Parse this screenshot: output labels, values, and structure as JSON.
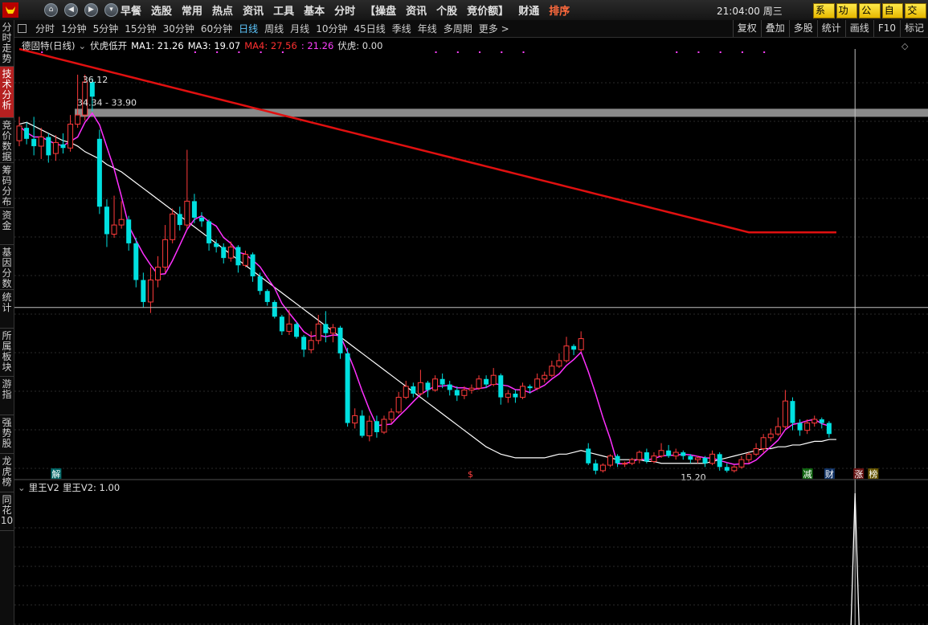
{
  "topbar": {
    "menu": [
      "早餐",
      "选股",
      "常用",
      "热点",
      "资讯",
      "工具",
      "基本",
      "分时",
      "【操盘",
      "资讯",
      "个股",
      "竞价额】",
      "财通",
      "排序"
    ],
    "clock": "21:04:00 周三",
    "right_buttons": [
      "系统",
      "功能",
      "公式",
      "自选",
      "交易"
    ],
    "colors": {
      "highlight": "#ff6a3d",
      "button_bg": "#ffd700"
    }
  },
  "periods": [
    "分时",
    "1分钟",
    "5分钟",
    "15分钟",
    "30分钟",
    "60分钟",
    "日线",
    "周线",
    "月线",
    "10分钟",
    "45日线",
    "季线",
    "年线",
    "多周期",
    "更多 >"
  ],
  "active_period": "日线",
  "tools": [
    "复权",
    "叠加",
    "多股",
    "统计",
    "画线",
    "F10",
    "标记"
  ],
  "sidebar": [
    {
      "label": "分时走势",
      "active": false
    },
    {
      "label": "技术分析",
      "active": true
    },
    {
      "label": "竞价数据",
      "active": false
    },
    {
      "label": "筹码分布",
      "active": false
    },
    {
      "label": "资金",
      "active": false
    },
    {
      "label": "基因分数",
      "active": false
    },
    {
      "label": "统计",
      "active": false
    },
    {
      "label": "所属板块",
      "active": false
    },
    {
      "label": "游指",
      "active": false
    },
    {
      "label": "强势股",
      "active": false
    },
    {
      "label": "龙虎榜",
      "active": false
    },
    {
      "label": "同花10",
      "active": false
    }
  ],
  "main_header": {
    "stock": "德固特(日线)",
    "indicator": "伏虎低开",
    "ma1": "MA1: 21.26",
    "ma3": "MA3: 19.07",
    "ma4": "MA4: 27.56",
    "ma_extra": ": 21.26",
    "fuhu": "伏虎: 0.00",
    "colors": {
      "ma1": "#ffffff",
      "ma3": "#ffffff",
      "ma4": "#ff3030",
      "ma_extra": "#ff40ff",
      "fuhu": "#dddddd"
    }
  },
  "lower_header": {
    "name": "里王V2",
    "value": "里王V2: 1.00"
  },
  "annotations": {
    "high": "36.12",
    "range": "34.34 - 33.90",
    "low": "15.20"
  },
  "markers": [
    {
      "text": "解",
      "bg": "#006666",
      "fg": "#ffffff",
      "k": 5
    },
    {
      "text": "$",
      "bg": "#000000",
      "fg": "#ff4040",
      "k": 62
    },
    {
      "text": "减",
      "bg": "#116611",
      "fg": "#ffffff",
      "k": 108
    },
    {
      "text": "财",
      "bg": "#113366",
      "fg": "#ffffff",
      "k": 111
    },
    {
      "text": "涨",
      "bg": "#661111",
      "fg": "#ffffff",
      "k": 115
    },
    {
      "text": "榜",
      "bg": "#665500",
      "fg": "#ffffff",
      "k": 117
    }
  ],
  "chart_data": {
    "type": "candlestick",
    "y_range": [
      14.2,
      37.6
    ],
    "resistance_band": [
      33.9,
      34.34
    ],
    "crosshair_price": 23.5,
    "crosshair_index": 115,
    "candles": [
      [
        32.6,
        33.4,
        33.9,
        32.3
      ],
      [
        33.3,
        32.7,
        33.6,
        32.4
      ],
      [
        32.7,
        32.3,
        33.9,
        31.8
      ],
      [
        32.3,
        32.8,
        33.3,
        31.6
      ],
      [
        32.8,
        31.8,
        33.0,
        31.4
      ],
      [
        31.9,
        32.5,
        32.9,
        31.5
      ],
      [
        32.4,
        32.2,
        33.0,
        31.9
      ],
      [
        32.2,
        33.5,
        34.0,
        32.0
      ],
      [
        33.5,
        34.0,
        36.2,
        33.3
      ],
      [
        34.0,
        35.8,
        36.2,
        33.7
      ],
      [
        35.8,
        35.0,
        36.0,
        34.2
      ],
      [
        32.7,
        29.0,
        33.2,
        28.6
      ],
      [
        29.0,
        27.5,
        29.4,
        26.8
      ],
      [
        27.5,
        28.0,
        29.6,
        27.3
      ],
      [
        28.0,
        28.3,
        29.3,
        27.8
      ],
      [
        28.3,
        27.0,
        28.5,
        26.6
      ],
      [
        27.0,
        25.0,
        27.3,
        24.6
      ],
      [
        25.0,
        23.8,
        25.4,
        23.5
      ],
      [
        23.8,
        25.0,
        25.7,
        23.2
      ],
      [
        25.0,
        25.7,
        26.3,
        24.6
      ],
      [
        25.7,
        27.2,
        28.0,
        25.4
      ],
      [
        27.2,
        28.6,
        28.9,
        27.0
      ],
      [
        28.6,
        28.0,
        29.0,
        27.7
      ],
      [
        28.0,
        29.3,
        32.1,
        27.8
      ],
      [
        29.3,
        28.4,
        29.7,
        28.1
      ],
      [
        28.4,
        28.2,
        28.7,
        27.9
      ],
      [
        28.2,
        27.0,
        28.3,
        26.6
      ],
      [
        27.0,
        26.8,
        27.2,
        26.5
      ],
      [
        26.8,
        26.2,
        27.0,
        25.9
      ],
      [
        26.2,
        26.8,
        27.1,
        26.0
      ],
      [
        26.8,
        25.8,
        26.9,
        25.4
      ],
      [
        25.8,
        26.4,
        26.6,
        25.7
      ],
      [
        26.4,
        25.2,
        26.5,
        24.9
      ],
      [
        25.2,
        24.4,
        25.4,
        24.2
      ],
      [
        24.4,
        23.8,
        24.5,
        23.6
      ],
      [
        23.8,
        23.0,
        23.9,
        22.9
      ],
      [
        23.0,
        22.2,
        23.1,
        22.0
      ],
      [
        22.2,
        22.6,
        23.4,
        22.0
      ],
      [
        22.6,
        21.9,
        22.7,
        21.8
      ],
      [
        21.9,
        21.2,
        22.0,
        20.8
      ],
      [
        21.2,
        21.7,
        22.2,
        21.0
      ],
      [
        21.7,
        22.6,
        23.1,
        21.5
      ],
      [
        22.6,
        22.1,
        23.3,
        21.6
      ],
      [
        22.1,
        22.4,
        22.6,
        21.6
      ],
      [
        22.4,
        21.0,
        22.5,
        20.7
      ],
      [
        21.0,
        17.2,
        21.3,
        17.0
      ],
      [
        17.2,
        17.6,
        18.0,
        16.9
      ],
      [
        17.6,
        16.5,
        17.9,
        16.4
      ],
      [
        16.5,
        17.3,
        17.6,
        16.2
      ],
      [
        17.3,
        16.7,
        17.6,
        16.4
      ],
      [
        16.7,
        17.4,
        17.6,
        16.6
      ],
      [
        17.4,
        17.8,
        18.0,
        17.2
      ],
      [
        17.8,
        18.6,
        18.9,
        17.7
      ],
      [
        18.6,
        19.2,
        19.5,
        18.5
      ],
      [
        19.2,
        18.8,
        19.4,
        18.6
      ],
      [
        18.8,
        19.4,
        20.1,
        18.7
      ],
      [
        19.4,
        19.0,
        19.5,
        18.6
      ],
      [
        19.0,
        19.6,
        19.8,
        18.9
      ],
      [
        19.6,
        19.3,
        19.9,
        19.1
      ],
      [
        19.3,
        19.0,
        19.5,
        18.7
      ],
      [
        19.0,
        18.7,
        19.2,
        18.4
      ],
      [
        18.7,
        19.0,
        19.2,
        18.5
      ],
      [
        19.0,
        19.1,
        19.3,
        18.8
      ],
      [
        19.1,
        19.6,
        19.8,
        19.0
      ],
      [
        19.6,
        19.3,
        19.8,
        19.1
      ],
      [
        19.3,
        19.8,
        20.2,
        19.2
      ],
      [
        19.8,
        18.6,
        19.9,
        18.2
      ],
      [
        18.6,
        18.8,
        19.0,
        18.3
      ],
      [
        18.8,
        18.6,
        19.0,
        18.3
      ],
      [
        18.6,
        19.2,
        19.4,
        18.5
      ],
      [
        19.2,
        19.1,
        19.3,
        18.8
      ],
      [
        19.1,
        19.6,
        19.9,
        19.0
      ],
      [
        19.6,
        19.8,
        20.0,
        19.4
      ],
      [
        19.8,
        20.3,
        20.6,
        19.7
      ],
      [
        20.3,
        20.6,
        21.0,
        20.2
      ],
      [
        20.6,
        21.4,
        21.9,
        20.5
      ],
      [
        21.4,
        21.2,
        21.5,
        20.9
      ],
      [
        21.2,
        21.8,
        22.2,
        21.1
      ],
      [
        15.8,
        15.0,
        16.1,
        14.9
      ],
      [
        15.0,
        14.6,
        15.2,
        14.4
      ],
      [
        14.6,
        14.9,
        15.0,
        14.5
      ],
      [
        14.9,
        15.4,
        15.5,
        14.8
      ],
      [
        15.4,
        15.0,
        15.5,
        14.8
      ],
      [
        15.0,
        15.0,
        15.1,
        14.8
      ],
      [
        15.0,
        15.2,
        15.3,
        14.9
      ],
      [
        15.2,
        15.6,
        15.7,
        15.0
      ],
      [
        15.6,
        15.1,
        15.8,
        15.0
      ],
      [
        15.1,
        15.4,
        15.6,
        15.0
      ],
      [
        15.4,
        15.7,
        16.1,
        15.3
      ],
      [
        15.7,
        15.4,
        16.0,
        15.3
      ],
      [
        15.4,
        15.6,
        15.8,
        15.2
      ],
      [
        15.6,
        15.4,
        15.7,
        15.2
      ],
      [
        15.4,
        15.2,
        15.5,
        15.0
      ],
      [
        15.2,
        15.3,
        15.4,
        15.0
      ],
      [
        15.3,
        15.0,
        15.4,
        14.8
      ],
      [
        15.0,
        15.5,
        15.7,
        14.9
      ],
      [
        15.5,
        14.8,
        15.6,
        14.6
      ],
      [
        14.8,
        14.6,
        15.0,
        14.5
      ],
      [
        14.6,
        14.8,
        14.9,
        14.5
      ],
      [
        14.8,
        15.2,
        15.4,
        14.7
      ],
      [
        15.2,
        15.5,
        15.6,
        15.0
      ],
      [
        15.5,
        15.8,
        16.1,
        15.4
      ],
      [
        15.8,
        16.4,
        16.6,
        15.6
      ],
      [
        16.4,
        16.6,
        16.9,
        16.2
      ],
      [
        16.6,
        17.0,
        17.5,
        16.5
      ],
      [
        17.0,
        18.4,
        19.0,
        16.9
      ],
      [
        18.4,
        17.2,
        18.6,
        16.8
      ],
      [
        17.2,
        16.8,
        17.4,
        16.5
      ],
      [
        16.8,
        17.2,
        17.4,
        16.6
      ],
      [
        17.2,
        17.4,
        17.6,
        17.0
      ],
      [
        17.4,
        17.2,
        17.5,
        16.9
      ],
      [
        17.2,
        16.6,
        17.3,
        16.4
      ]
    ],
    "ma_white": [
      33.5,
      33.6,
      33.4,
      33.2,
      33.0,
      32.8,
      32.6,
      32.5,
      32.3,
      32.0,
      31.8,
      31.6,
      31.3,
      31.1,
      30.9,
      30.6,
      30.3,
      30.0,
      29.7,
      29.4,
      29.1,
      28.8,
      28.5,
      28.2,
      27.9,
      27.6,
      27.3,
      27.0,
      26.7,
      26.4,
      26.1,
      25.8,
      25.5,
      25.2,
      24.9,
      24.6,
      24.3,
      24.0,
      23.7,
      23.4,
      23.1,
      22.8,
      22.5,
      22.2,
      21.9,
      21.6,
      21.3,
      21.0,
      20.7,
      20.4,
      20.1,
      19.8,
      19.5,
      19.2,
      18.9,
      18.6,
      18.3,
      18.0,
      17.7,
      17.4,
      17.1,
      16.8,
      16.5,
      16.2,
      15.9,
      15.7,
      15.5,
      15.4,
      15.3,
      15.3,
      15.3,
      15.3,
      15.3,
      15.4,
      15.5,
      15.5,
      15.6,
      15.7,
      15.6,
      15.5,
      15.4,
      15.3,
      15.2,
      15.2,
      15.2,
      15.2,
      15.1,
      15.1,
      15.0,
      15.0,
      15.0,
      15.0,
      15.0,
      15.0,
      15.0,
      15.1,
      15.2,
      15.3,
      15.4,
      15.5,
      15.6,
      15.7,
      15.8,
      15.8,
      15.9,
      15.9,
      16.0,
      16.0,
      16.1,
      16.2,
      16.2,
      16.3,
      16.3
    ],
    "ma_red": [
      37.6,
      37.5,
      37.4,
      37.3,
      37.2,
      37.1,
      37.0,
      36.9,
      36.8,
      36.7,
      36.6,
      36.5,
      36.4,
      36.3,
      36.2,
      36.1,
      36.0,
      35.9,
      35.8,
      35.7,
      35.6,
      35.5,
      35.4,
      35.3,
      35.2,
      35.1,
      35.0,
      34.9,
      34.8,
      34.7,
      34.6,
      34.5,
      34.4,
      34.3,
      34.2,
      34.1,
      34.0,
      33.9,
      33.8,
      33.7,
      33.6,
      33.5,
      33.4,
      33.3,
      33.2,
      33.1,
      33.0,
      32.9,
      32.8,
      32.7,
      32.6,
      32.5,
      32.4,
      32.3,
      32.2,
      32.1,
      32.0,
      31.9,
      31.8,
      31.7,
      31.6,
      31.5,
      31.4,
      31.3,
      31.2,
      31.1,
      31.0,
      30.9,
      30.8,
      30.7,
      30.6,
      30.5,
      30.4,
      30.3,
      30.2,
      30.1,
      30.0,
      29.9,
      29.8,
      29.7,
      29.6,
      29.5,
      29.4,
      29.3,
      29.2,
      29.1,
      29.0,
      28.9,
      28.8,
      28.7,
      28.6,
      28.5,
      28.4,
      28.3,
      28.2,
      28.1,
      28.0,
      27.9,
      27.8,
      27.7,
      27.6,
      27.6,
      27.6,
      27.6,
      27.6,
      27.6,
      27.6,
      27.6,
      27.6,
      27.6,
      27.6,
      27.6,
      27.6
    ]
  }
}
